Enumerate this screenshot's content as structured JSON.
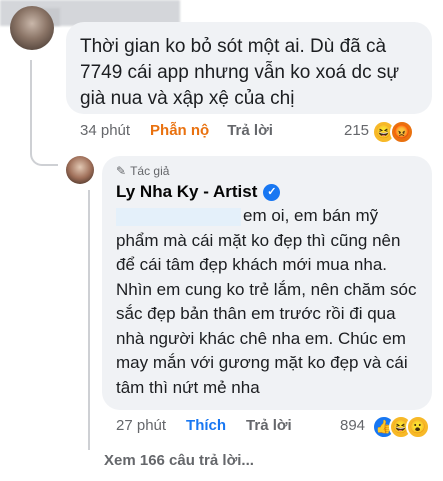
{
  "comment1": {
    "text": "Thời gian ko bỏ sót một ai. Dù đã cà 7749 cái app nhưng vẫn ko xoá dc sự già nua và xập xệ của chị",
    "time": "34 phút",
    "reaction_label": "Phẫn nộ",
    "reaction_color": "#e9710f",
    "reply_label": "Trả lời",
    "reaction_count": "215",
    "reaction_icons": [
      "haha-icon",
      "angry-icon"
    ]
  },
  "comment2": {
    "badge": "Tác giả",
    "author": "Ly Nha Ky - Artist",
    "text": "em oi, em bán mỹ phẩm mà cái mặt ko đẹp thì cũng nên để cái tâm đẹp khách mới mua nha. Nhìn em cung ko trẻ lắm, nên chăm sóc sắc đẹp bản thân em trước rồi đi qua nhà người khác chê nha em. Chúc em may mắn với gương mặt ko đẹp và cái tâm thì nứt mẻ nha",
    "time": "27 phút",
    "like_label": "Thích",
    "like_color": "#1877f2",
    "reply_label": "Trả lời",
    "reaction_count": "894",
    "reaction_icons": [
      "like-icon",
      "haha-icon",
      "wow-icon"
    ]
  },
  "more_replies": "Xem 166 câu trả lời..."
}
